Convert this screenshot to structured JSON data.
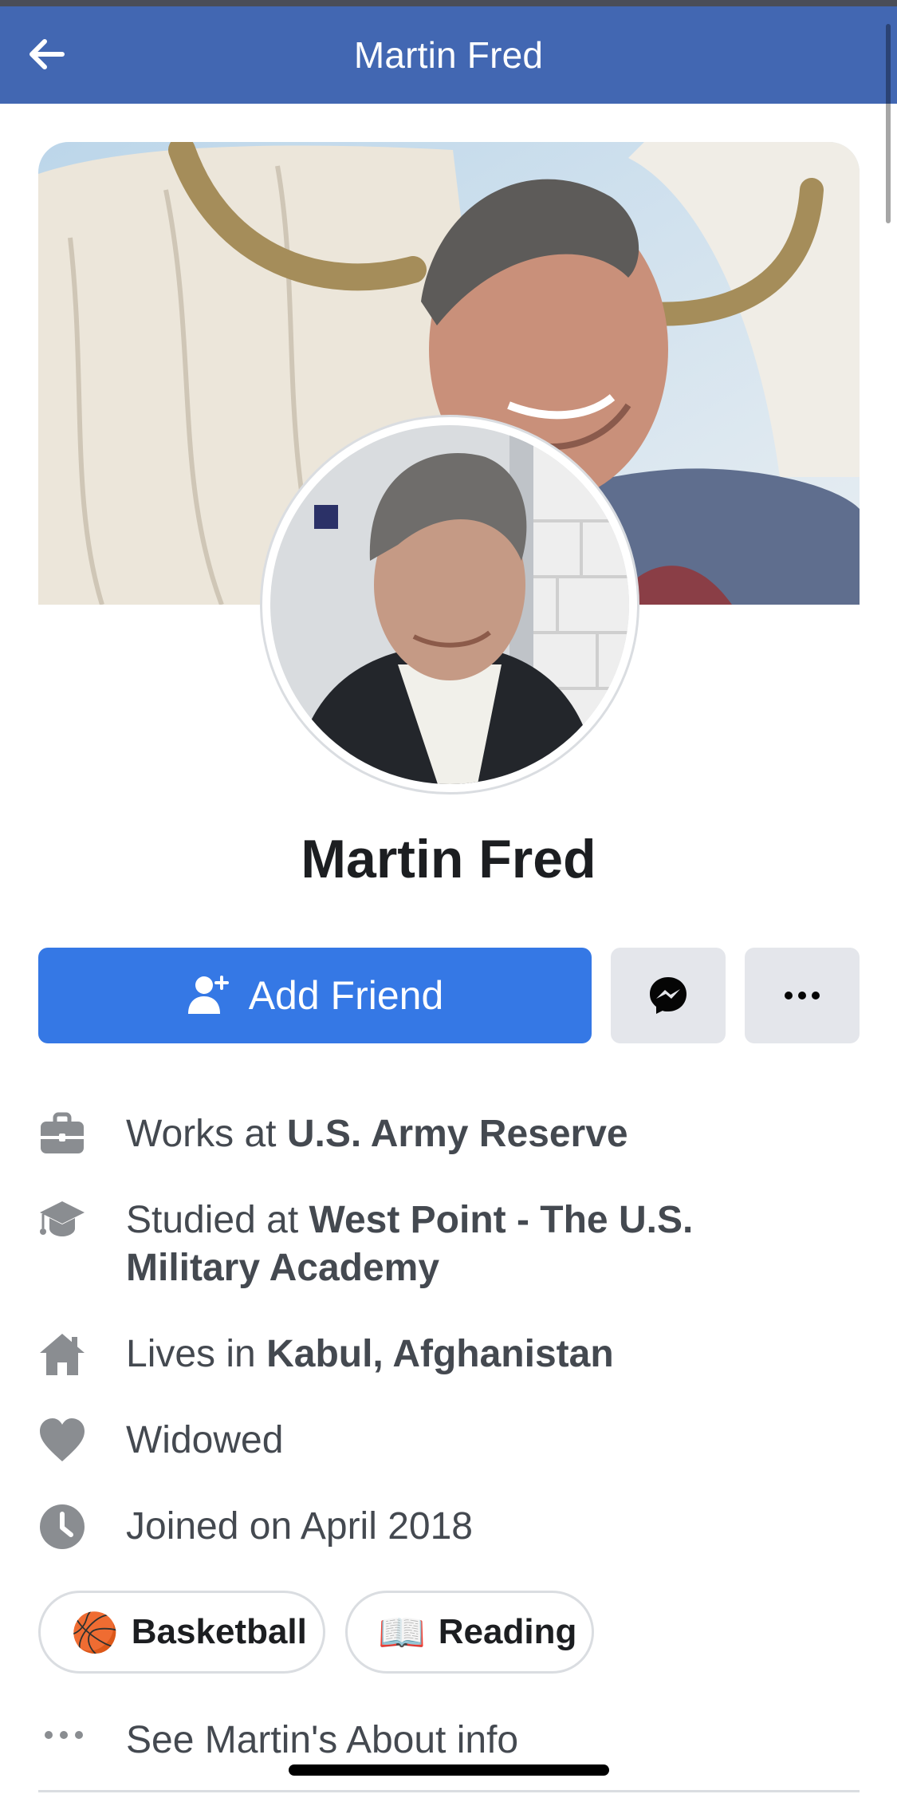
{
  "header": {
    "title": "Martin Fred"
  },
  "profile": {
    "name": "Martin Fred"
  },
  "actions": {
    "add_friend": "Add Friend"
  },
  "intro": {
    "work_prefix": "Works at ",
    "work_place": "U.S. Army Reserve",
    "study_prefix": "Studied at ",
    "study_place": "West Point - The U.S. Military Academy",
    "lives_prefix": "Lives in ",
    "lives_place": "Kabul, Afghanistan",
    "relationship": "Widowed",
    "joined": "Joined on April 2018"
  },
  "hobbies": [
    {
      "emoji": "🏀",
      "label": "Basketball"
    },
    {
      "emoji": "📖",
      "label": "Reading"
    }
  ],
  "see_more": "See Martin's About info",
  "colors": {
    "nav": "#4267b2",
    "primary_button": "#3578e5",
    "secondary_button": "#e4e6eb",
    "icon_gray": "#8a8d91"
  },
  "icons": [
    "back-arrow-icon",
    "add-friend-icon",
    "messenger-icon",
    "more-dots-icon",
    "briefcase-icon",
    "graduation-cap-icon",
    "home-icon",
    "heart-icon",
    "clock-icon",
    "ellipsis-icon"
  ]
}
